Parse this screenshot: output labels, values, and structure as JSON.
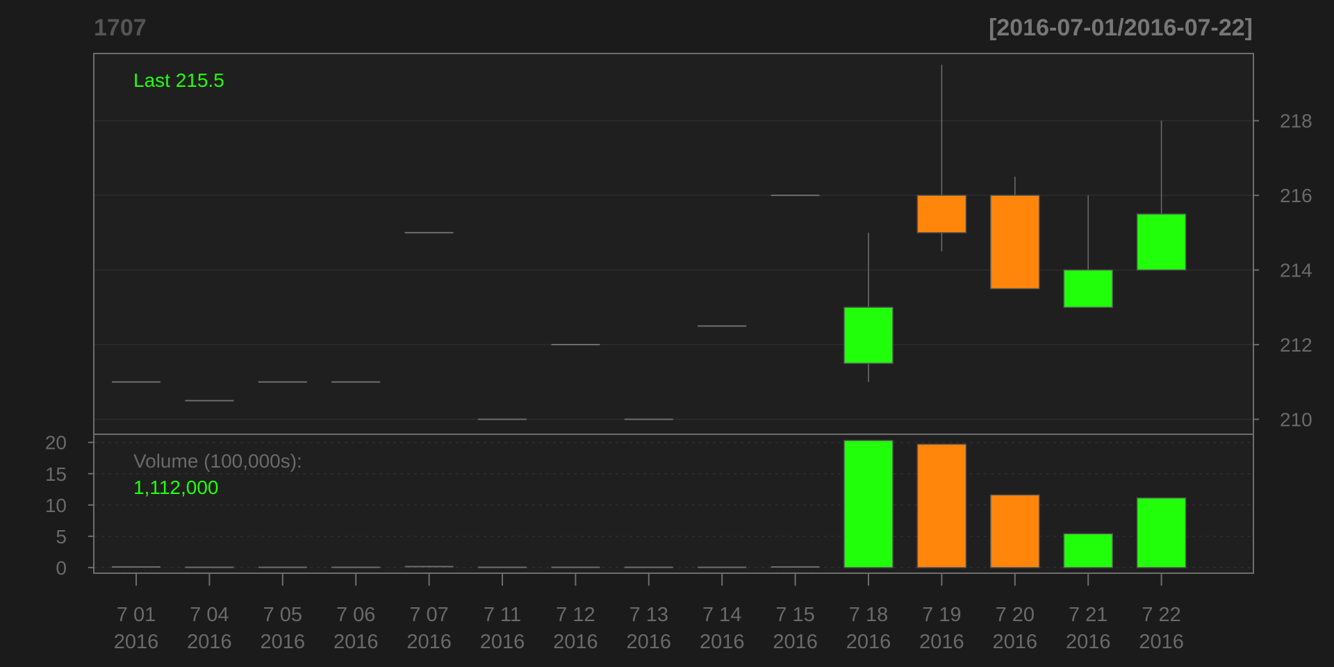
{
  "header": {
    "title": "1707",
    "date_range": "[2016-07-01/2016-07-22]"
  },
  "price_panel": {
    "last_label": "Last 215.5"
  },
  "volume_panel": {
    "label": "Volume (100,000s):",
    "value": "1,112,000"
  },
  "colors": {
    "background": "#1b1b1b",
    "panel": "#1f1f1f",
    "frame": "#6e6e6e",
    "text": "#6a6a6a",
    "up": "#22ff0a",
    "down": "#ff860a",
    "grid": "#2e2e2e",
    "wick": "#6e6e6e"
  },
  "chart_data": [
    {
      "type": "candlestick",
      "categories": [
        "7 01",
        "7 04",
        "7 05",
        "7 06",
        "7 07",
        "7 11",
        "7 12",
        "7 13",
        "7 14",
        "7 15",
        "7 18",
        "7 19",
        "7 20",
        "7 21",
        "7 22"
      ],
      "category_years": [
        "2016",
        "2016",
        "2016",
        "2016",
        "2016",
        "2016",
        "2016",
        "2016",
        "2016",
        "2016",
        "2016",
        "2016",
        "2016",
        "2016",
        "2016"
      ],
      "open": [
        211,
        210.5,
        211,
        211,
        215,
        210,
        212,
        210,
        212.5,
        216,
        211.5,
        216,
        216,
        213,
        214
      ],
      "high": [
        211,
        210.5,
        211,
        211,
        215,
        210,
        212,
        210,
        212.5,
        216,
        215,
        219.5,
        216.5,
        216,
        218
      ],
      "low": [
        211,
        210.5,
        211,
        211,
        215,
        210,
        212,
        210,
        212.5,
        216,
        211,
        214.5,
        213.5,
        213,
        214
      ],
      "close": [
        211,
        210.5,
        211,
        211,
        215,
        210,
        212,
        210,
        212.5,
        216,
        213,
        215,
        213.5,
        214,
        215.5
      ],
      "direction": [
        "flat",
        "flat",
        "flat",
        "flat",
        "flat",
        "flat",
        "flat",
        "flat",
        "flat",
        "flat",
        "up",
        "down",
        "down",
        "up",
        "up"
      ],
      "yticks": [
        210,
        212,
        214,
        216,
        218
      ],
      "ylim": [
        209.6,
        219.8
      ],
      "grid": true
    },
    {
      "type": "bar",
      "categories": [
        "7 01",
        "7 04",
        "7 05",
        "7 06",
        "7 07",
        "7 11",
        "7 12",
        "7 13",
        "7 14",
        "7 15",
        "7 18",
        "7 19",
        "7 20",
        "7 21",
        "7 22"
      ],
      "values": [
        0.1,
        0.05,
        0.05,
        0.05,
        0.15,
        0.05,
        0.05,
        0.05,
        0.05,
        0.1,
        20.3,
        19.7,
        11.6,
        5.4,
        11.12
      ],
      "direction": [
        "flat",
        "flat",
        "flat",
        "flat",
        "flat",
        "flat",
        "flat",
        "flat",
        "flat",
        "flat",
        "up",
        "down",
        "down",
        "up",
        "up"
      ],
      "yticks": [
        0,
        5,
        10,
        15,
        20
      ],
      "ylim": [
        -0.9,
        21.3
      ],
      "grid": true
    }
  ]
}
